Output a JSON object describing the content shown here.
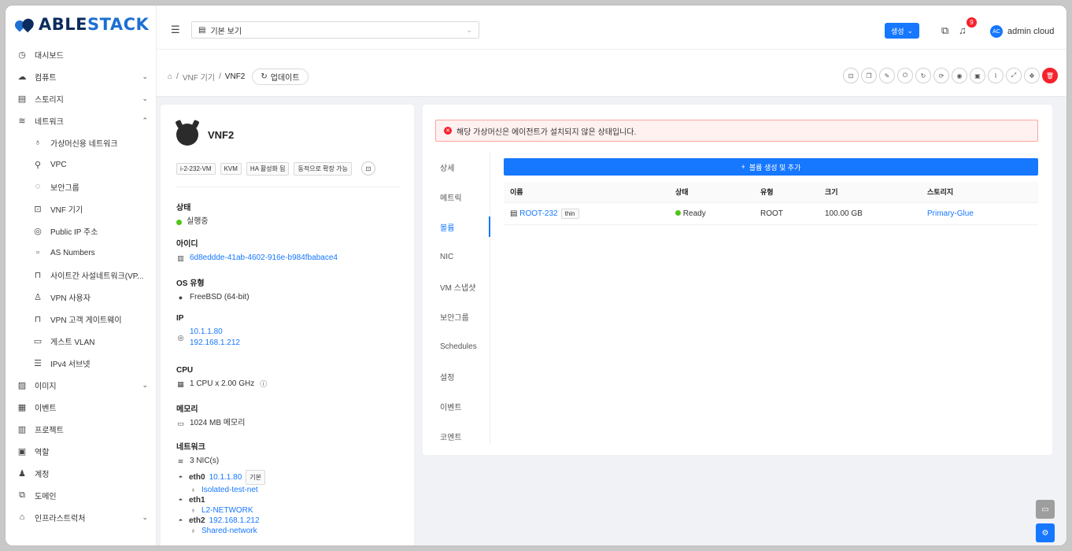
{
  "brand": {
    "part1": "ABLE",
    "part2": "STACK"
  },
  "sidebar": {
    "items": [
      {
        "label": "대시보드",
        "icon": "dashboard-icon",
        "glyph": "◷"
      },
      {
        "label": "컴퓨트",
        "icon": "cloud-icon",
        "glyph": "☁",
        "chev": "⌄"
      },
      {
        "label": "스토리지",
        "icon": "database-icon",
        "glyph": "▤",
        "chev": "⌄"
      },
      {
        "label": "네트워크",
        "icon": "wifi-icon",
        "glyph": "≋",
        "chev": "⌃"
      }
    ],
    "network_sub": [
      {
        "label": "가상머신용 네트워크",
        "icon": "apartment-icon",
        "glyph": "♁"
      },
      {
        "label": "VPC",
        "icon": "deployment-unit-icon",
        "glyph": "⚲"
      },
      {
        "label": "보안그룹",
        "icon": "fire-icon",
        "glyph": "◌"
      },
      {
        "label": "VNF 기기",
        "icon": "gateway-icon",
        "glyph": "⊡"
      },
      {
        "label": "Public IP 주소",
        "icon": "environment-icon",
        "glyph": "◎"
      },
      {
        "label": "AS Numbers",
        "icon": "partition-icon",
        "glyph": "▫"
      },
      {
        "label": "사이트간 사설네트워크(VP...",
        "icon": "lock-icon",
        "glyph": "⊓"
      },
      {
        "label": "VPN 사용자",
        "icon": "user-icon",
        "glyph": "♙"
      },
      {
        "label": "VPN 고객 게이트웨이",
        "icon": "lock-icon",
        "glyph": "⊓"
      },
      {
        "label": "게스트 VLAN",
        "icon": "folder-icon",
        "glyph": "▭"
      },
      {
        "label": "IPv4 서브넷",
        "icon": "subnet-icon",
        "glyph": "☰"
      }
    ],
    "items2": [
      {
        "label": "이미지",
        "icon": "picture-icon",
        "glyph": "▨",
        "chev": "⌄"
      },
      {
        "label": "이벤트",
        "icon": "schedule-icon",
        "glyph": "▦"
      },
      {
        "label": "프로젝트",
        "icon": "project-icon",
        "glyph": "▥"
      },
      {
        "label": "역할",
        "icon": "idcard-icon",
        "glyph": "▣"
      },
      {
        "label": "계정",
        "icon": "team-icon",
        "glyph": "♟"
      },
      {
        "label": "도메인",
        "icon": "block-icon",
        "glyph": "⧉"
      },
      {
        "label": "인프라스트럭처",
        "icon": "bank-icon",
        "glyph": "⌂",
        "chev": "⌄"
      }
    ]
  },
  "header": {
    "view_label": "기본 보기",
    "create_label": "생성",
    "notif_count": "9",
    "avatar_initials": "AC",
    "username": "admin cloud"
  },
  "breadcrumb": {
    "home": "⌂",
    "level1": "VNF 기기",
    "current": "VNF2",
    "refresh": "업데이트"
  },
  "vm": {
    "name": "VNF2",
    "tags": [
      "i-2-232-VM",
      "KVM",
      "HA 활성화 됨",
      "동적으로 확장 가능"
    ],
    "status_label": "상태",
    "status": "실행중",
    "id_label": "아이디",
    "id": "6d8eddde-41ab-4602-916e-b984fbabace4",
    "os_label": "OS 유형",
    "os": "FreeBSD (64-bit)",
    "ip_label": "IP",
    "ip1": "10.1.1.80",
    "ip2": "192.168.1.212",
    "cpu_label": "CPU",
    "cpu": "1 CPU x 2.00 GHz",
    "mem_label": "메모리",
    "mem": "1024 MB 메모리",
    "net_label": "네트워크",
    "nic_count": "3 NIC(s)",
    "nics": [
      {
        "name": "eth0",
        "ip": "10.1.1.80",
        "tag": "기본",
        "network": "Isolated-test-net"
      },
      {
        "name": "eth1",
        "ip": "",
        "tag": "",
        "network": "L2-NETWORK"
      },
      {
        "name": "eth2",
        "ip": "192.168.1.212",
        "tag": "",
        "network": "Shared-network"
      }
    ]
  },
  "alert": "해당 가상머신은 에이전트가 설치되지 않은 상태입니다.",
  "tabs": [
    "상세",
    "메트릭",
    "볼륨",
    "NIC",
    "VM 스냅샷",
    "보안그룹",
    "Schedules",
    "설정",
    "이벤트",
    "코멘트"
  ],
  "active_tab": "볼륨",
  "volumes": {
    "add_label": "볼륨 생성 및 추가",
    "columns": [
      "이름",
      "상태",
      "유형",
      "크기",
      "스토리지"
    ],
    "rows": [
      {
        "name": "ROOT-232",
        "tag": "thin",
        "state": "Ready",
        "type": "ROOT",
        "size": "100.00 GB",
        "storage": "Primary-Glue"
      }
    ]
  },
  "colors": {
    "primary": "#1677ff",
    "danger": "#f5222d",
    "success": "#52c41a"
  }
}
